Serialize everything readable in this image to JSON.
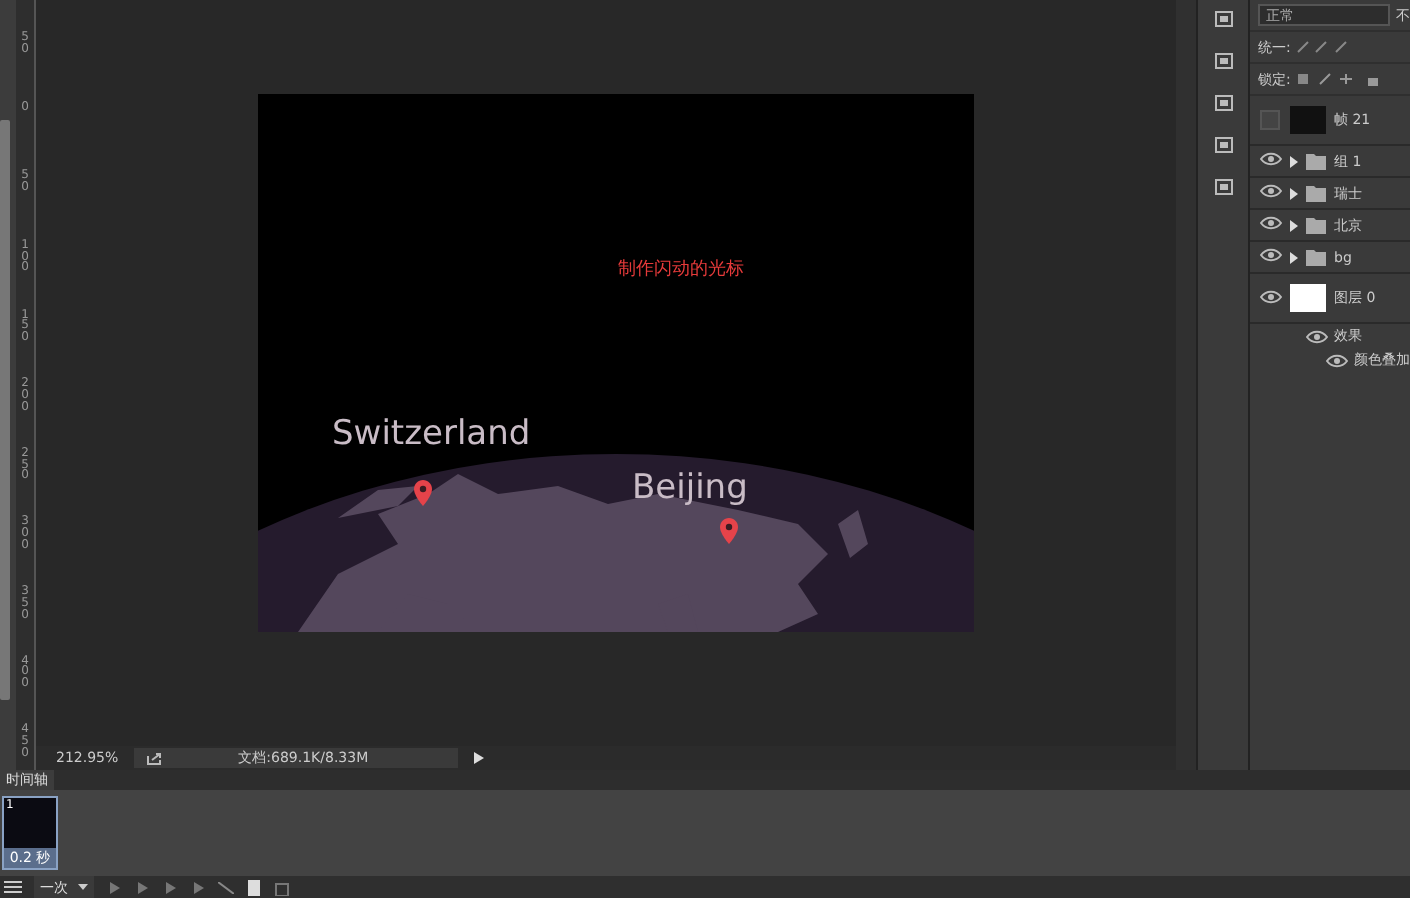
{
  "ruler": {
    "labels": [
      "50",
      "0",
      "50",
      "100",
      "150",
      "200",
      "250",
      "300",
      "350",
      "400",
      "450"
    ]
  },
  "canvas": {
    "caption": "制作闪动的光标",
    "places": [
      {
        "name": "Switzerland",
        "kind": "left"
      },
      {
        "name": "Beijing",
        "kind": "right"
      }
    ]
  },
  "status_bar": {
    "zoom": "212.95%",
    "document": "文档:689.1K/8.33M"
  },
  "timeline": {
    "tab": "时间轴",
    "frames": [
      {
        "number": "1",
        "delay": "0.2 秒",
        "selected": true
      }
    ],
    "loop": "一次"
  },
  "layers_panel": {
    "blend_mode": "正常",
    "opacity_label": "不",
    "unify_label": "统一:",
    "lock_label": "锁定:",
    "layers": [
      {
        "name": "帧 21",
        "kind": "image",
        "visible": false
      },
      {
        "name": "组 1",
        "kind": "group",
        "visible": true
      },
      {
        "name": "瑞士",
        "kind": "group",
        "visible": true
      },
      {
        "name": "北京",
        "kind": "group",
        "visible": true
      },
      {
        "name": "bg",
        "kind": "group",
        "visible": true
      },
      {
        "name": "图层 0",
        "kind": "layer",
        "visible": true,
        "effects_label": "效果",
        "effects": [
          {
            "name": "颜色叠加"
          }
        ]
      }
    ]
  }
}
